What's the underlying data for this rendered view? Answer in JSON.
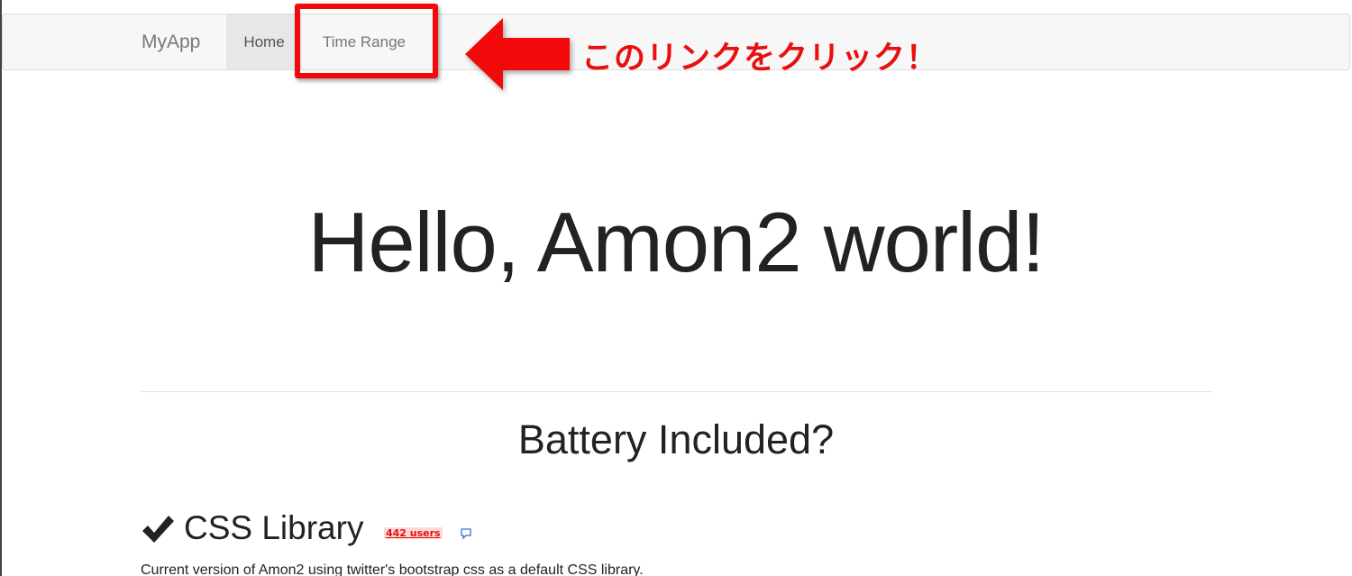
{
  "navbar": {
    "brand": "MyApp",
    "items": [
      {
        "label": "Home",
        "active": true
      },
      {
        "label": "Time Range",
        "active": false
      }
    ]
  },
  "annotation": {
    "callout_text": "このリンクをクリック！",
    "color": "#e8100f"
  },
  "hero": {
    "title": "Hello, Amon2 world!"
  },
  "section": {
    "title": "Battery Included?"
  },
  "features": [
    {
      "icon": "checkmark-icon",
      "title": "CSS Library",
      "users_badge": "442 users",
      "badge_icon": "comment-icon",
      "description": "Current version of Amon2 using twitter's bootstrap css as a default CSS library."
    }
  ],
  "colors": {
    "accent": "#f20a0a",
    "navbar_bg": "#f7f7f7",
    "active_tab_bg": "#e7e7e7"
  }
}
